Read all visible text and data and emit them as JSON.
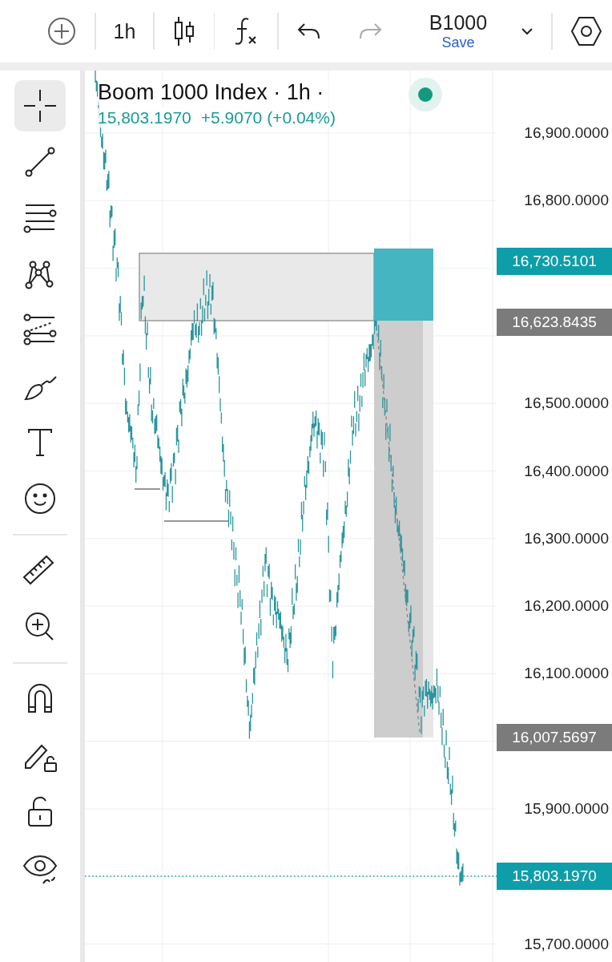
{
  "toolbar": {
    "interval": "1h",
    "symbol": "B1000",
    "save_label": "Save",
    "undo": {
      "disabled": false
    },
    "redo": {
      "disabled": true
    }
  },
  "tool_groups": [
    [
      {
        "kind": "crosshair",
        "selected": true
      },
      {
        "kind": "trend-line",
        "selected": false
      },
      {
        "kind": "fib",
        "selected": false
      },
      {
        "kind": "pattern",
        "selected": false
      },
      {
        "kind": "forecast",
        "selected": false
      },
      {
        "kind": "brush",
        "selected": false
      },
      {
        "kind": "text",
        "selected": false
      },
      {
        "kind": "emoji",
        "selected": false
      }
    ],
    [
      {
        "kind": "ruler",
        "selected": false
      },
      {
        "kind": "zoom",
        "selected": false
      }
    ],
    [
      {
        "kind": "magnet",
        "selected": false
      },
      {
        "kind": "lock-drawing",
        "selected": false
      },
      {
        "kind": "lock",
        "selected": false
      },
      {
        "kind": "eye",
        "selected": false
      }
    ]
  ],
  "legend": {
    "title": "Boom 1000 Index · 1h ·",
    "price": "15,803.1970",
    "change": "+5.9070 (+0.04%)"
  },
  "price_axis": [
    "16,900.0000",
    "16,800.0000",
    "16,500.0000",
    "16,400.0000",
    "16,300.0000",
    "16,200.0000",
    "16,100.0000",
    "15,900.0000",
    "15,700.0000"
  ],
  "price_tags": [
    {
      "label": "16,730.5101",
      "color": "#0e9ea9"
    },
    {
      "label": "16,623.8435",
      "color": "#7b7b7b"
    },
    {
      "label": "16,007.5697",
      "color": "#7b7b7b"
    },
    {
      "label": "15,803.1970",
      "color": "#0e9ea9"
    }
  ]
}
